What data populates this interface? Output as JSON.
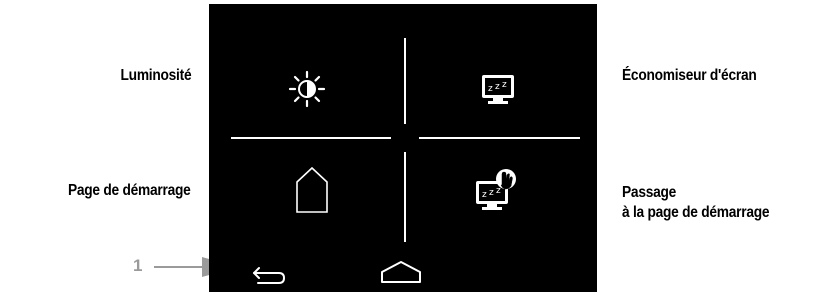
{
  "labels": {
    "luminosite": "Luminosité",
    "economiseur": "Économiseur d'écran",
    "page_demarrage": "Page de démarrage",
    "passage_line1": "Passage",
    "passage_line2": "à la page de démarrage"
  },
  "callout": {
    "number": "1",
    "target": "back-icon"
  },
  "screen": {
    "background": "#000000",
    "foreground": "#ffffff",
    "tiles": [
      {
        "icon": "brightness-icon"
      },
      {
        "icon": "screensaver-icon"
      },
      {
        "icon": "home-outline-icon"
      },
      {
        "icon": "screensaver-touch-icon"
      }
    ],
    "nav_icons": [
      "back-icon",
      "home-nav-icon"
    ]
  },
  "colors": {
    "callout_gray": "#9a9a9a",
    "label_text": "#000000"
  }
}
